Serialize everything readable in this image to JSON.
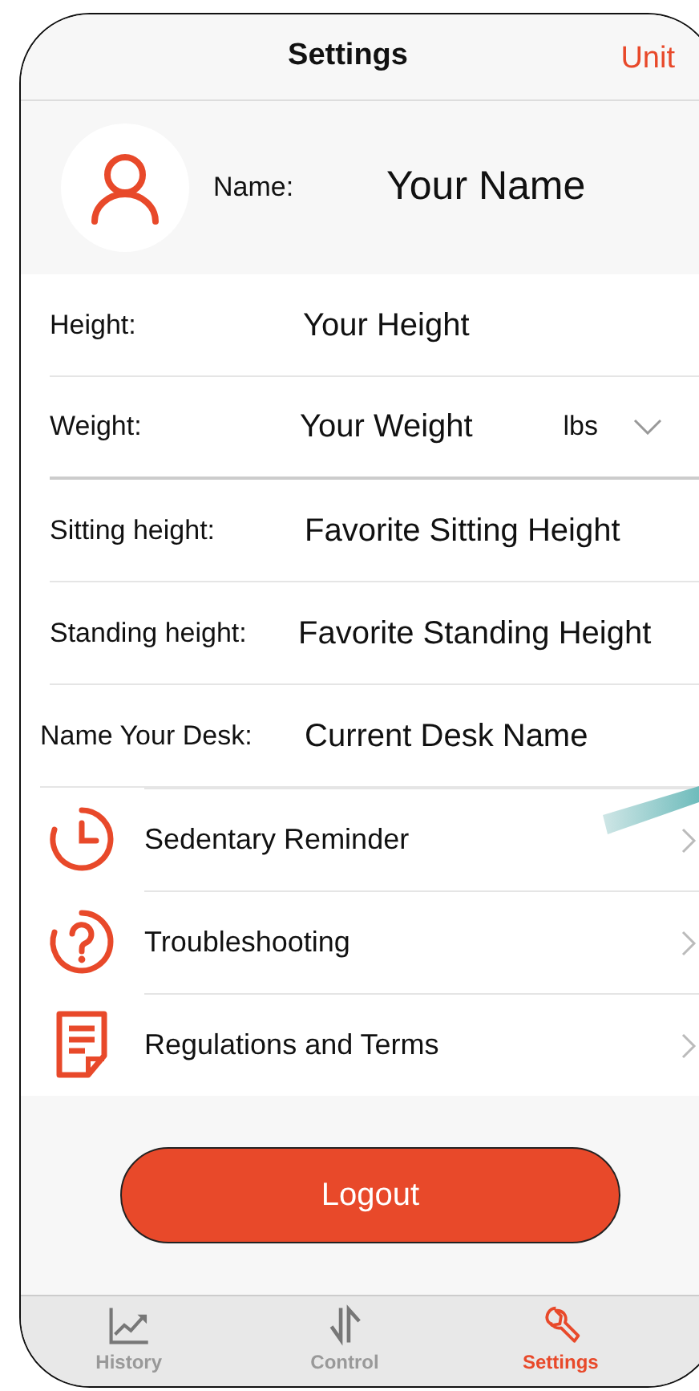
{
  "header": {
    "title": "Settings",
    "action": "Unit"
  },
  "profile": {
    "label": "Name:",
    "value": "Your Name"
  },
  "fields": [
    {
      "kind": "text",
      "label": "Height:",
      "value": "Your Height"
    },
    {
      "kind": "select",
      "label": "Weight:",
      "value": "Your Weight",
      "unit": "lbs"
    },
    {
      "kind": "text",
      "label": "Sitting height:",
      "value": "Favorite Sitting Height"
    },
    {
      "kind": "text",
      "label": "Standing height:",
      "value": "Favorite Standing Height"
    },
    {
      "kind": "text",
      "label": "Name Your Desk:",
      "value": "Current Desk Name"
    }
  ],
  "menu": [
    {
      "label": "Sedentary Reminder"
    },
    {
      "label": "Troubleshooting"
    },
    {
      "label": "Regulations and Terms"
    }
  ],
  "logout": "Logout",
  "tabs": [
    {
      "label": "History",
      "selected": false
    },
    {
      "label": "Control",
      "selected": false
    },
    {
      "label": "Settings",
      "selected": true
    }
  ]
}
